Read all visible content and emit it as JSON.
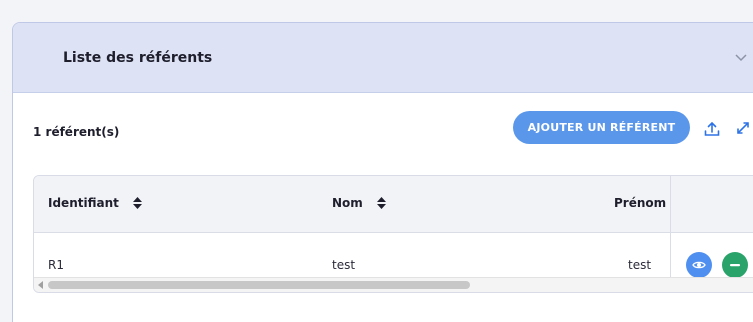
{
  "panel": {
    "title": "Liste des référents"
  },
  "toolbar": {
    "count_label": "1 référent(s)",
    "add_button_label": "AJOUTER UN RÉFÉRENT"
  },
  "table": {
    "columns": [
      "Identifiant",
      "Nom",
      "Prénom"
    ],
    "rows": [
      {
        "identifiant": "R1",
        "nom": "test",
        "prenom": "test"
      }
    ]
  },
  "colors": {
    "header_bg": "#dde3f4",
    "primary": "#5a97ea",
    "view_button": "#4f8ff0",
    "remove_button": "#2aa36b"
  },
  "icons": [
    "chevron-down-icon",
    "upload-icon",
    "expand-icon",
    "sort-icon",
    "eye-icon",
    "minus-icon"
  ]
}
